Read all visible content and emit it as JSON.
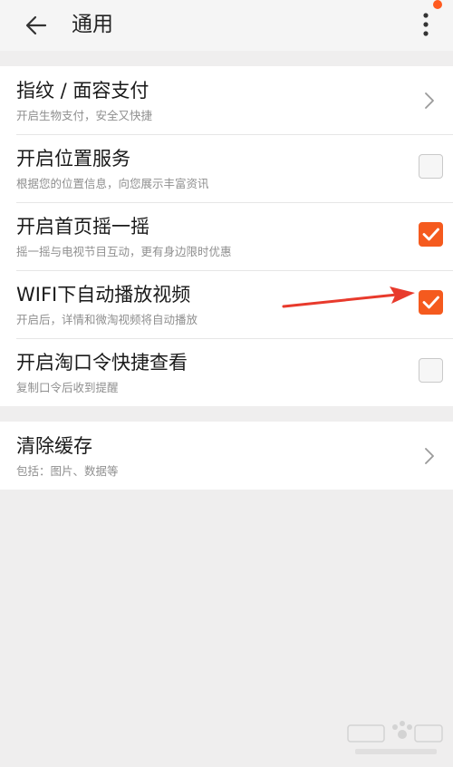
{
  "header": {
    "title": "通用",
    "back_icon": "back-arrow-icon",
    "more_icon": "more-vertical-icon"
  },
  "settings": {
    "items": [
      {
        "title": "指纹 / 面容支付",
        "subtitle": "开启生物支付，安全又快捷",
        "control": "chevron"
      },
      {
        "title": "开启位置服务",
        "subtitle": "根据您的位置信息，向您展示丰富资讯",
        "control": "checkbox",
        "checked": false
      },
      {
        "title": "开启首页摇一摇",
        "subtitle": "摇一摇与电视节目互动，更有身边限时优惠",
        "control": "checkbox",
        "checked": true
      },
      {
        "title": "WIFI下自动播放视频",
        "subtitle": "开启后，详情和微淘视频将自动播放",
        "control": "checkbox",
        "checked": true
      },
      {
        "title": "开启淘口令快捷查看",
        "subtitle": "复制口令后收到提醒",
        "control": "checkbox",
        "checked": false
      }
    ]
  },
  "cache": {
    "title": "清除缓存",
    "subtitle": "包括：图片、数据等",
    "control": "chevron"
  },
  "colors": {
    "accent": "#f55a1e",
    "background": "#efeeee",
    "annotation_arrow": "#e83a2c"
  }
}
